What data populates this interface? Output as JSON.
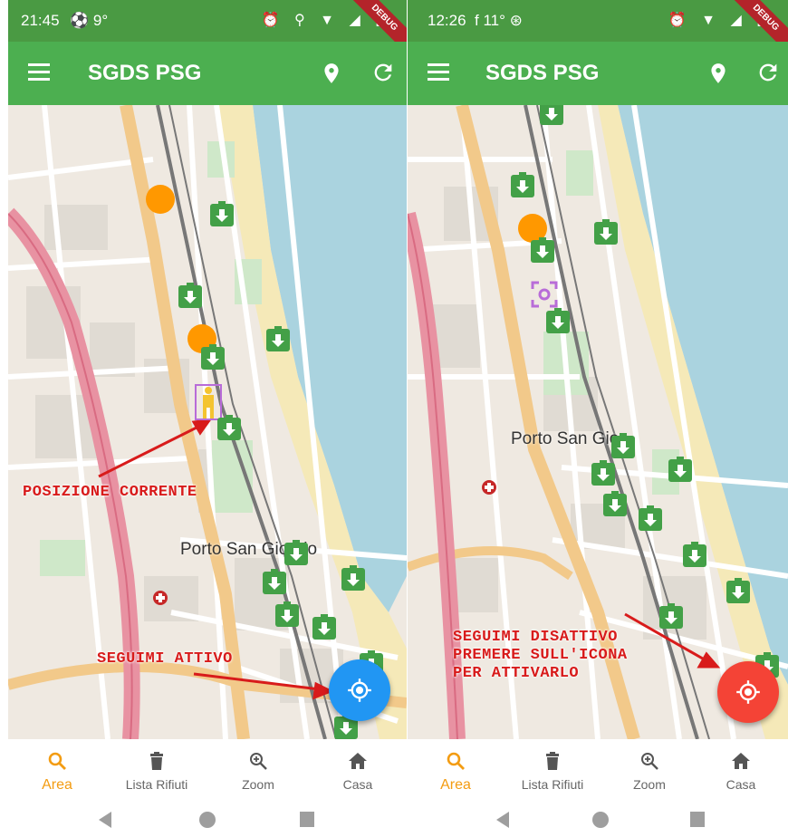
{
  "colors": {
    "appbar": "#4caf50",
    "statusbar": "#4a9a43",
    "marker": "#43a047",
    "orange": "#ff9800",
    "fab_active": "#2196f3",
    "fab_inactive": "#f44336",
    "annotation": "#d81b1b",
    "nav_active": "#f39c12"
  },
  "left": {
    "status_time": "21:45",
    "status_extra": "⚽ 9°",
    "status_icons": "⏰ ⚲ ▼ ◢ ▮",
    "debug_banner": "DEBUG",
    "app_title": "SGDS PSG",
    "map_label_town": "Porto San Giorgio",
    "annotation_position": "POSIZIONE CORRENTE",
    "annotation_follow": "SEGUIMI ATTIVO",
    "fab_state": "active",
    "icons": {
      "menu": "menu-icon",
      "pin": "location-pin-icon",
      "refresh": "refresh-icon",
      "fab": "gps-fixed-icon"
    }
  },
  "right": {
    "status_time": "12:26",
    "status_extra": "f 11° ⊛",
    "status_icons": "⏰ ▼ ◢ ▮",
    "debug_banner": "DEBUG",
    "app_title": "SGDS PSG",
    "map_label_town": "Porto San Gio",
    "annotation_follow_lines": [
      "SEGUIMI DISATTIVO",
      "PREMERE SULL'ICONA",
      "PER ATTIVARLO"
    ],
    "fab_state": "inactive",
    "icons": {
      "menu": "menu-icon",
      "pin": "location-pin-icon",
      "refresh": "refresh-icon",
      "fab": "gps-target-icon"
    }
  },
  "bottom_nav": [
    {
      "label": "Area",
      "icon": "search-icon",
      "active": true
    },
    {
      "label": "Lista Rifiuti",
      "icon": "trash-icon",
      "active": false
    },
    {
      "label": "Zoom",
      "icon": "zoom-in-icon",
      "active": false
    },
    {
      "label": "Casa",
      "icon": "home-icon",
      "active": false
    }
  ],
  "system_nav": [
    "back-icon",
    "home-circle-icon",
    "recents-icon"
  ]
}
